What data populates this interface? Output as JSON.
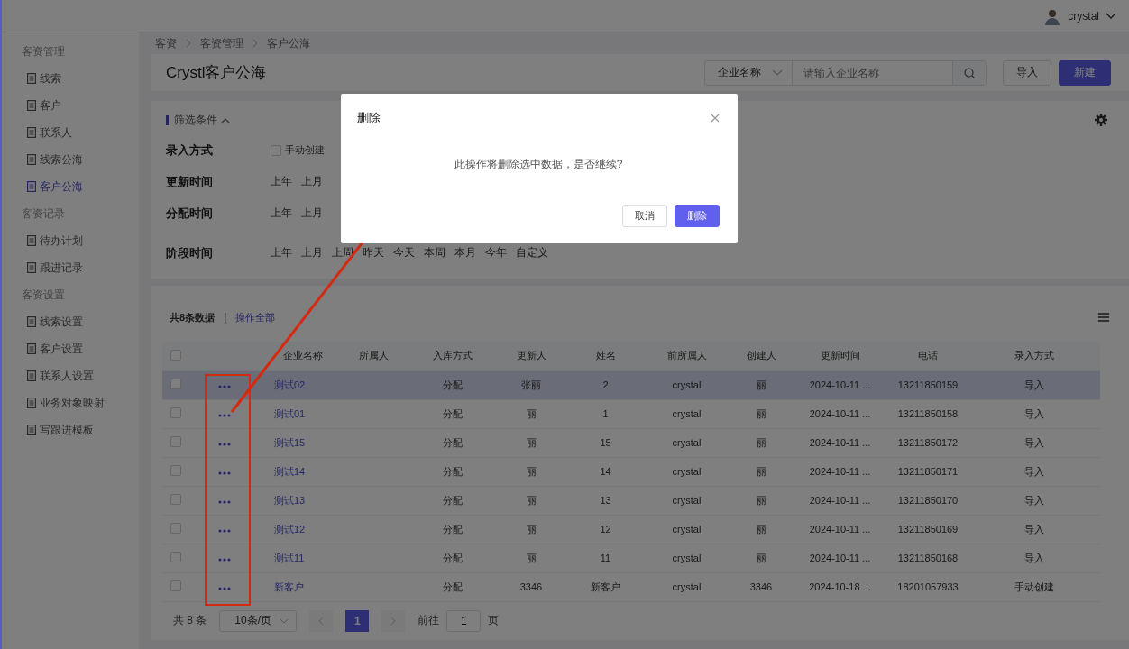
{
  "header": {
    "user": "crystal"
  },
  "sidebar": {
    "groups": [
      {
        "title": "客资管理",
        "items": [
          {
            "label": "线索",
            "selected": false
          },
          {
            "label": "客户",
            "selected": false
          },
          {
            "label": "联系人",
            "selected": false
          },
          {
            "label": "线索公海",
            "selected": false
          },
          {
            "label": "客户公海",
            "selected": true
          }
        ]
      },
      {
        "title": "客资记录",
        "items": [
          {
            "label": "待办计划",
            "selected": false
          },
          {
            "label": "跟进记录",
            "selected": false
          }
        ]
      },
      {
        "title": "客资设置",
        "items": [
          {
            "label": "线索设置",
            "selected": false
          },
          {
            "label": "客户设置",
            "selected": false
          },
          {
            "label": "联系人设置",
            "selected": false
          },
          {
            "label": "业务对象映射",
            "selected": false
          },
          {
            "label": "写跟进模板",
            "selected": false
          }
        ]
      }
    ]
  },
  "breadcrumb": [
    "客资",
    "客资管理",
    "客户公海"
  ],
  "page_title": "Crystl客户公海",
  "search": {
    "field_select": "企业名称",
    "placeholder": "请输入企业名称"
  },
  "buttons": [
    {
      "label": "导入",
      "kind": "default"
    },
    {
      "label": "新建",
      "kind": "primary"
    }
  ],
  "filter": {
    "title": "筛选条件",
    "expanded": true,
    "rows": [
      {
        "label": "录入方式",
        "kind": "checkbox",
        "options": [
          {
            "label": "手动创建",
            "checked": false
          }
        ]
      },
      {
        "label": "更新时间",
        "kind": "chips",
        "options": [
          "上年",
          "上月"
        ]
      },
      {
        "label": "分配时间",
        "kind": "chips",
        "options": [
          "上年",
          "上月"
        ]
      },
      {
        "label": "阶段时间",
        "kind": "chips",
        "options": [
          "上年",
          "上月",
          "上周",
          "昨天",
          "今天",
          "本周",
          "本月",
          "今年",
          "自定义"
        ]
      }
    ]
  },
  "table": {
    "summary": "共8条数据",
    "separator": "|",
    "bulk_action": "操作全部",
    "select_all": {
      "checked": false
    },
    "columns": [
      "企业名称",
      "所属人",
      "入库方式",
      "更新人",
      "姓名",
      "前所属人",
      "创建人",
      "更新时间",
      "电话",
      "录入方式"
    ],
    "rows": [
      {
        "selected": false,
        "highlighted": true,
        "cells": [
          "测试02",
          "",
          "分配",
          "张丽",
          "2",
          "crystal",
          "丽",
          "2024-10-11 ...",
          "13211850159",
          "导入"
        ]
      },
      {
        "selected": false,
        "highlighted": false,
        "cells": [
          "测试01",
          "",
          "分配",
          "丽",
          "1",
          "crystal",
          "丽",
          "2024-10-11 ...",
          "13211850158",
          "导入"
        ]
      },
      {
        "selected": false,
        "highlighted": false,
        "cells": [
          "测试15",
          "",
          "分配",
          "丽",
          "15",
          "crystal",
          "丽",
          "2024-10-11 ...",
          "13211850172",
          "导入"
        ]
      },
      {
        "selected": false,
        "highlighted": false,
        "cells": [
          "测试14",
          "",
          "分配",
          "丽",
          "14",
          "crystal",
          "丽",
          "2024-10-11 ...",
          "13211850171",
          "导入"
        ]
      },
      {
        "selected": false,
        "highlighted": false,
        "cells": [
          "测试13",
          "",
          "分配",
          "丽",
          "13",
          "crystal",
          "丽",
          "2024-10-11 ...",
          "13211850170",
          "导入"
        ]
      },
      {
        "selected": false,
        "highlighted": false,
        "cells": [
          "测试12",
          "",
          "分配",
          "丽",
          "12",
          "crystal",
          "丽",
          "2024-10-11 ...",
          "13211850169",
          "导入"
        ]
      },
      {
        "selected": false,
        "highlighted": false,
        "cells": [
          "测试11",
          "",
          "分配",
          "丽",
          "11",
          "crystal",
          "丽",
          "2024-10-11 ...",
          "13211850168",
          "导入"
        ]
      },
      {
        "selected": false,
        "highlighted": false,
        "cells": [
          "新客户",
          "",
          "分配",
          "3346",
          "新客户",
          "crystal",
          "3346",
          "2024-10-18 ...",
          "18201057933",
          "手动创建"
        ]
      }
    ]
  },
  "pagination": {
    "total": "共 8 条",
    "page_size": "10条/页",
    "pages": [
      {
        "label": "1",
        "selected": true
      }
    ],
    "goto_label": "前往",
    "goto_value": "1",
    "goto_suffix": "页"
  },
  "dialog": {
    "title": "删除",
    "message": "此操作将删除选中数据，是否继续?",
    "buttons": [
      {
        "label": "取消",
        "kind": "default"
      },
      {
        "label": "删除",
        "kind": "primary"
      }
    ]
  }
}
